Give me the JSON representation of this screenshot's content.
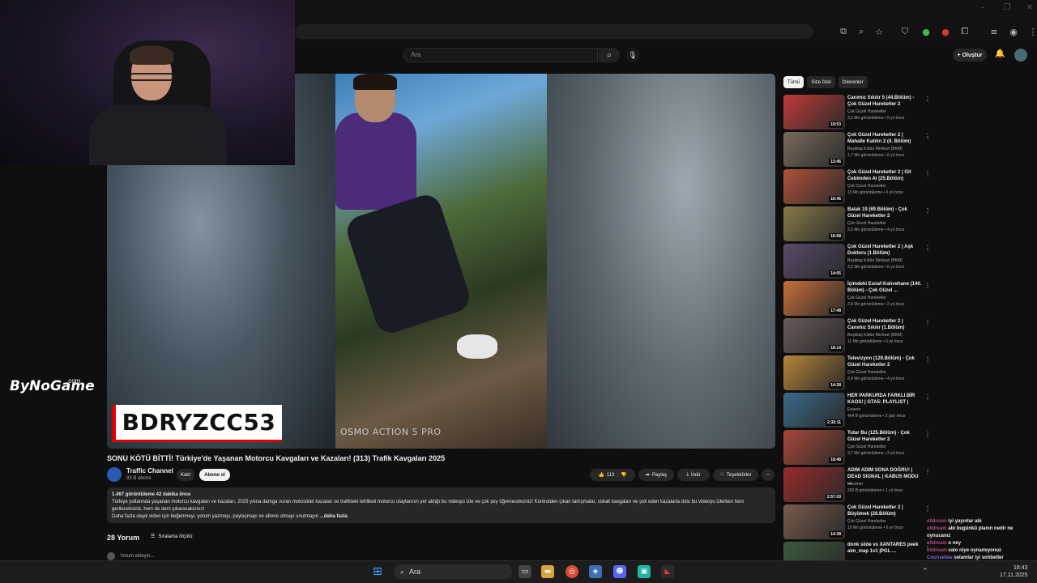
{
  "browser": {
    "ext_icons": [
      "cast-icon",
      "zoom-icon",
      "star-icon",
      "shield-icon",
      "extension-green-icon",
      "extension-red-icon",
      "puzzle-icon",
      "media-icon",
      "profile-icon",
      "menu-icon"
    ],
    "ext_badges": {
      "green": "10",
      "red": "3"
    }
  },
  "youtube": {
    "search_placeholder": "Ara",
    "create_label": "Oluştur"
  },
  "video": {
    "watermark": "OSMO ACTION 5 PRO",
    "overlay_name": "BDRYZCC53",
    "brand": "ByNoGame",
    "brand_suffix": ".com",
    "title": "SONU KÖTÜ BİTTİ! Türkiye'de Yaşanan Motorcu Kavgaları ve Kazaları! (313) Trafik Kavgaları 2025",
    "channel": "Traffic Channel",
    "subscribers": "93 B abone",
    "join": "Katıl",
    "subscribe": "Abone ol",
    "likes": "113",
    "share": "Paylaş",
    "download": "İndir",
    "thanks": "Teşekkürler",
    "description": {
      "stats": "1.467 görüntüleme  42 dakika önce",
      "line1": "Türkiye yollarında yaşanan motorcu kavgaları ve kazaları, 2025 yılına damga vuran motosiklet kazaları ve trafikteki tehlikeli motorcu olaylarının yer aldığı bu videoyu izle ve çok şey öğreneceksiniz! Kontrolden çıkan tartışmalar, sokak kavgaları ve şok eden kazalarla dolu bu videoyu izlerken hem",
      "line2": "gerileceksiniz, hem de ders çıkaracaksınız!",
      "line3": "Daha fazla olaylı video için beğenmeyi, yorum yazmayı, paylaşmayı ve abone olmayı unutmayın",
      "more": "...daha fazla"
    },
    "comments_count": "28 Yorum",
    "sort_label": "Sıralama ölçütü:",
    "add_comment": "Yorum ekleyin..."
  },
  "sidebar": {
    "chips": [
      "Tümü",
      "Size özel",
      "İzlenenler"
    ],
    "items": [
      {
        "title": "Canımız Sıkılır 5 (44.Bölüm) - Çok Güzel Hareketler 2",
        "channel": "Çok Güzel Hareketler",
        "meta": "3,2 Mn görüntüleme • 5 yıl önce",
        "dur": "19:53",
        "color": "#c23a3a"
      },
      {
        "title": "Çok Güzel Hareketler 2 | Mahalle Katılırı 2 (4. Bölüm)",
        "channel": "Beşiktaş Kültür Merkezi (BKM)",
        "meta": "1,7 Mn görüntüleme • 6 yıl önce",
        "dur": "13:46",
        "color": "#7a6b5a"
      },
      {
        "title": "Çok Güzel Hareketler 2 | Git Cebimden Al (25.Bölüm)",
        "channel": "Çok Güzel Hareketler",
        "meta": "13 Mn görüntüleme • 6 yıl önce",
        "dur": "16:46",
        "color": "#b0523a"
      },
      {
        "title": "Batak 19 (69.Bölüm) - Çok Güzel Hareketler 2",
        "channel": "Çok Güzel Hareketler",
        "meta": "3,3 Mn görüntüleme • 4 yıl önce",
        "dur": "16:58",
        "color": "#8a7a4a"
      },
      {
        "title": "Çok Güzel Hareketler 2 | Aşk Doktoru (1.Bölüm)",
        "channel": "Beşiktaş Kültür Merkezi (BKM)",
        "meta": "3,9 Mn görüntüleme • 6 yıl önce",
        "dur": "14:05",
        "color": "#5a4a6a"
      },
      {
        "title": "İçimdeki Esnaf-Kahvehane (140. Bölüm) - Çok Güzel ...",
        "channel": "Çok Güzel Hareketler",
        "meta": "2,8 Mn görüntüleme • 2 yıl önce",
        "dur": "17:48",
        "color": "#c9703a"
      },
      {
        "title": "Çok Güzel Hareketler 2 | Canımız Sıkılır (1.Bölüm)",
        "channel": "Beşiktaş Kültür Merkezi (BKM)",
        "meta": "11 Mn görüntüleme • 6 yıl önce",
        "dur": "18:14",
        "color": "#6a5a5a"
      },
      {
        "title": "Televizyon (129.Bölüm) - Çok Güzel Hareketler 2",
        "channel": "Çok Güzel Hareketler",
        "meta": "2,4 Mn görüntüleme • 4 yıl önce",
        "dur": "14:28",
        "color": "#b8863a"
      },
      {
        "title": "HER PARKURDA FARKLI BİR KAOS! | GTA5: PLAYLIST |",
        "channel": "Eraeon",
        "meta": "464 B görüntüleme • 2 gün önce",
        "dur": "2:32:11",
        "color": "#3a6a8a"
      },
      {
        "title": "Tutar Bu (125.Bölüm) - Çok Güzel Hareketler 2",
        "channel": "Çok Güzel Hareketler",
        "meta": "3,7 Mn görüntüleme • 3 yıl önce",
        "dur": "18:48",
        "color": "#a8483a"
      },
      {
        "title": "ADIM ADIM SONA DOĞRU! | DEAD SIGNAL | KABUS MODU ...",
        "channel": "Mikemer",
        "meta": "202 B görüntüleme • 1 yıl önce",
        "dur": "2:57:03",
        "color": "#9a2a2a"
      },
      {
        "title": "Çok Güzel Hareketler 2 | Büyümek (28.Bölüm)",
        "channel": "Çok Güzel Hareketler",
        "meta": "10 Mn görüntüleme • 6 yıl önce",
        "dur": "14:38",
        "color": "#7a5a4a"
      },
      {
        "title": "donk slide vs XANTARES peek aim_map 1v1 |PGL ...",
        "channel": "",
        "meta": "",
        "dur": "",
        "color": "#3a5a3a"
      }
    ]
  },
  "chat": [
    {
      "user": "elldream",
      "msg": "iyi yayınlar abi",
      "cls": "user"
    },
    {
      "user": "elldream",
      "msg": "abi bugünkü planın nedir ne oynucanız",
      "cls": "user"
    },
    {
      "user": "elldream",
      "msg": "o ney",
      "cls": "user"
    },
    {
      "user": "elldream",
      "msg": "valo niye oynamıyonuz",
      "cls": "user"
    },
    {
      "user": "Counselaw",
      "msg": "selamlar iyi sohbetler",
      "cls": "user2"
    },
    {
      "user": "",
      "msg": "bende FPS başladım valo ....",
      "cls": "user"
    },
    {
      "user": "",
      "msg": "yüzden sordum",
      "cls": "user"
    }
  ],
  "taskbar": {
    "search_label": "Ara",
    "time": "18:43",
    "date": "17.11.2025"
  }
}
